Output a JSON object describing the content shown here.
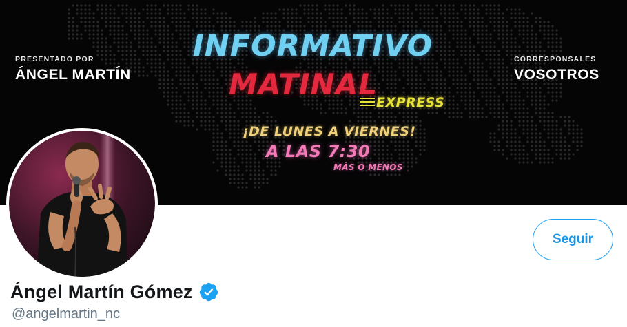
{
  "banner": {
    "presenter_label": "PRESENTADO POR",
    "presenter_name": "ÁNGEL MARTÍN",
    "correspondents_label": "CORRESPONSALES",
    "correspondents_name": "VOSOTROS",
    "title_line1": "INFORMATIVO",
    "title_line2": "MATINAL",
    "title_tag": "EXPRESS",
    "days": "¡DE LUNES A VIERNES!",
    "time": "A LAS 7:30",
    "time_note": "MÁS O MENOS"
  },
  "profile": {
    "display_name": "Ángel Martín Gómez",
    "handle": "@angelmartin_nc",
    "verified": true,
    "follow_label": "Seguir"
  },
  "colors": {
    "accent": "#1da1f2",
    "title_blue": "#6fd0f2",
    "title_red": "#e4293f",
    "title_yellow": "#e7e23a",
    "title_pink": "#f47ab8"
  },
  "icons": {
    "verified": "verified-badge-icon"
  }
}
